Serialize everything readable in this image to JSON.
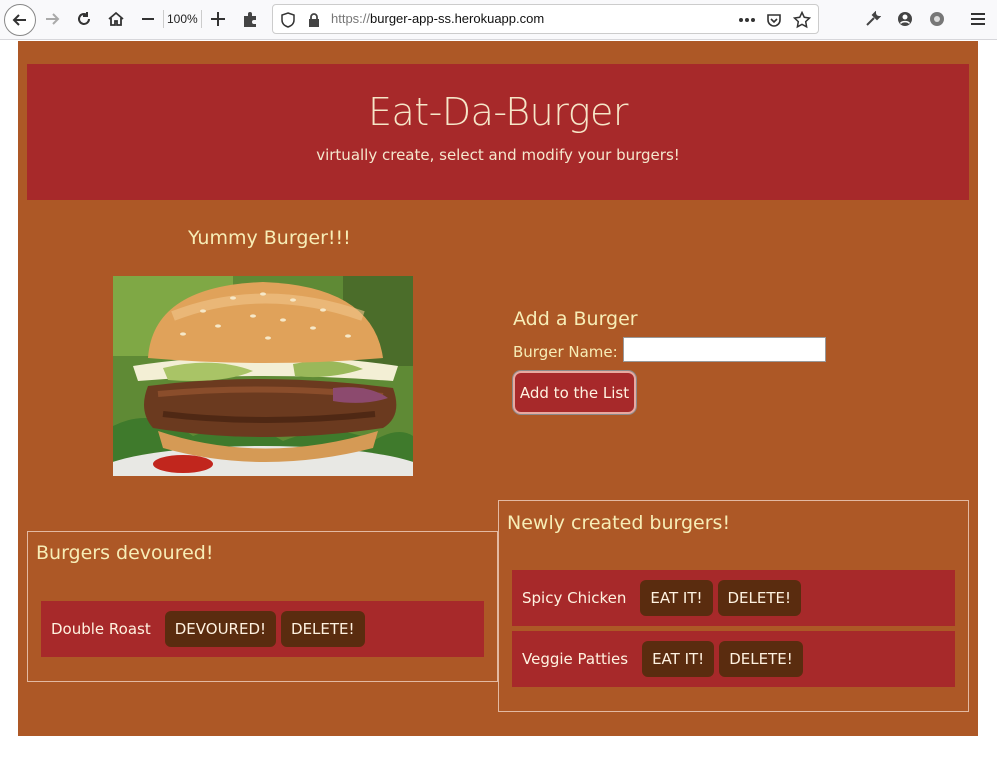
{
  "browser": {
    "zoom": "100%",
    "url_prefix": "https://",
    "url_host": "burger-app-ss.herokuapp.com",
    "icons": [
      "back-icon",
      "forward-icon",
      "reload-icon",
      "home-icon",
      "zoom-out-icon",
      "zoom-in-icon",
      "extensions-icon",
      "shield-icon",
      "lock-icon",
      "more-icon",
      "pocket-icon",
      "bookmark-star-icon",
      "wrench-icon",
      "account-icon",
      "addon-icon",
      "menu-icon"
    ]
  },
  "header": {
    "title": "Eat-Da-Burger",
    "subtitle": "virtually create, select and modify your burgers!"
  },
  "showcase": {
    "caption": "Yummy Burger!!!"
  },
  "add_form": {
    "title": "Add a Burger",
    "name_label": "Burger Name:",
    "name_value": "",
    "submit_label": "Add to the List"
  },
  "devoured": {
    "title": "Burgers devoured!",
    "items": [
      {
        "name": "Double Roast",
        "action": "DEVOURED!",
        "delete": "DELETE!"
      }
    ]
  },
  "new_burgers": {
    "title": "Newly created burgers!",
    "items": [
      {
        "name": "Spicy Chicken",
        "action": "EAT IT!",
        "delete": "DELETE!"
      },
      {
        "name": "Veggie Patties",
        "action": "EAT IT!",
        "delete": "DELETE!"
      }
    ]
  },
  "colors": {
    "page_bg": "#ad5826",
    "header_bg": "#a7292a",
    "row_bg": "#a7292a",
    "pill_bg": "#5a2c0f",
    "heading_text": "#f7edb6"
  }
}
